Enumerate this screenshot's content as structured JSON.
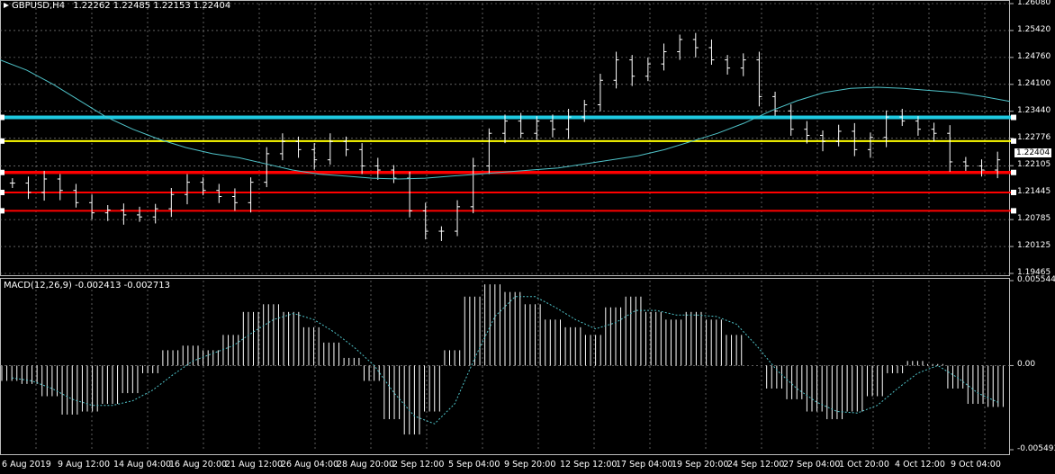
{
  "header": {
    "symbol": "GBPUSD,H4",
    "ohlc": "1.22262 1.22485 1.22153 1.22404"
  },
  "macd_header": {
    "label": "MACD(12,26,9) -0.002413 -0.002713"
  },
  "colors": {
    "background": "#000000",
    "candle": "#ffffff",
    "grid": "#9a9a9a",
    "ma": "#4fc3c9",
    "resistance": "#1ec9e0",
    "mid_level": "#ffff00",
    "support": "#ff0000"
  },
  "chart_data": [
    {
      "type": "line",
      "title": "GBPUSD,H4",
      "ylim": [
        1.19465,
        1.2608
      ],
      "y_ticks": [
        "1.26080",
        "1.25420",
        "1.24760",
        "1.24100",
        "1.23440",
        "1.22776",
        "1.22404",
        "1.22105",
        "1.21445",
        "1.20785",
        "1.20125",
        "1.19465"
      ],
      "x_ticks": [
        "6 Aug 2019",
        "9 Aug 12:00",
        "14 Aug 04:00",
        "16 Aug 20:00",
        "21 Aug 12:00",
        "26 Aug 04:00",
        "28 Aug 20:00",
        "2 Sep 12:00",
        "5 Sep 04:00",
        "9 Sep 20:00",
        "12 Sep 12:00",
        "17 Sep 04:00",
        "19 Sep 20:00",
        "24 Sep 12:00",
        "27 Sep 04:00",
        "1 Oct 20:00",
        "4 Oct 12:00",
        "9 Oct 04:00"
      ],
      "current_price": "1.22404",
      "series": [
        {
          "type": "price",
          "values": [
            1.2168,
            1.2145,
            1.2178,
            1.215,
            1.212,
            1.2095,
            1.2102,
            1.209,
            1.2085,
            1.2105,
            1.214,
            1.217,
            1.215,
            1.2135,
            1.212,
            1.217,
            1.224,
            1.227,
            1.225,
            1.2225,
            1.227,
            1.225,
            1.221,
            1.22,
            1.218,
            1.21,
            1.205,
            1.205,
            1.211,
            1.221,
            1.229,
            1.232,
            1.229,
            1.232,
            1.23,
            1.233,
            1.236,
            1.242,
            1.247,
            1.243,
            1.246,
            1.249,
            1.252,
            1.25,
            1.247,
            1.245,
            1.247,
            1.238,
            1.2345,
            1.23,
            1.2285,
            1.227,
            1.2295,
            1.225,
            1.228,
            1.233,
            1.232,
            1.23,
            1.229,
            1.222,
            1.221,
            1.22,
            1.2225
          ]
        },
        {
          "type": "moving_average",
          "values": [
            1.247,
            1.2445,
            1.241,
            1.237,
            1.233,
            1.23,
            1.2275,
            1.2255,
            1.224,
            1.223,
            1.2215,
            1.22,
            1.219,
            1.2185,
            1.218,
            1.2178,
            1.218,
            1.2185,
            1.219,
            1.2195,
            1.22,
            1.2205,
            1.2215,
            1.2225,
            1.2235,
            1.225,
            1.227,
            1.229,
            1.2315,
            1.2345,
            1.237,
            1.239,
            1.24,
            1.2403,
            1.24,
            1.2395,
            1.239,
            1.238,
            1.2368
          ]
        }
      ],
      "horizontal_levels": [
        {
          "name": "resistance",
          "value": 1.2329,
          "color": "#1ec9e0"
        },
        {
          "name": "mid",
          "value": 1.2271,
          "color": "#ffff00"
        },
        {
          "name": "support-1",
          "value": 1.2194,
          "color": "#ff0000"
        },
        {
          "name": "support-2",
          "value": 1.2145,
          "color": "#ff0000"
        },
        {
          "name": "support-3",
          "value": 1.21,
          "color": "#ff0000"
        }
      ]
    },
    {
      "type": "bar",
      "title": "MACD(12,26,9) -0.002413 -0.002713",
      "ylim": [
        -0.005493,
        0.005544
      ],
      "y_ticks": [
        "0.005544",
        "0.00",
        "-0.005493"
      ],
      "series": [
        {
          "name": "MACD",
          "values": [
            -0.001,
            -0.0012,
            -0.002,
            -0.0032,
            -0.003,
            -0.0025,
            -0.0018,
            -0.0005,
            0.001,
            0.0013,
            0.001,
            0.002,
            0.0035,
            0.004,
            0.0035,
            0.0025,
            0.0015,
            0.0005,
            -0.001,
            -0.0035,
            -0.0045,
            -0.003,
            0.001,
            0.0045,
            0.0053,
            0.0048,
            0.004,
            0.003,
            0.0025,
            0.002,
            0.0038,
            0.0045,
            0.0035,
            0.003,
            0.0035,
            0.003,
            0.002,
            0.0,
            -0.0015,
            -0.0022,
            -0.003,
            -0.0035,
            -0.003,
            -0.002,
            -0.0005,
            0.0003,
            0.0001,
            -0.0015,
            -0.0025,
            -0.0027
          ]
        },
        {
          "name": "Signal",
          "values": [
            -0.0008,
            -0.001,
            -0.0015,
            -0.0022,
            -0.0026,
            -0.0026,
            -0.0023,
            -0.0016,
            -0.0006,
            0.0003,
            0.0008,
            0.0013,
            0.0022,
            0.003,
            0.0034,
            0.003,
            0.0022,
            0.0012,
            0.0,
            -0.0018,
            -0.0033,
            -0.0038,
            -0.0025,
            0.0005,
            0.0032,
            0.0045,
            0.0045,
            0.0038,
            0.003,
            0.0024,
            0.0028,
            0.0036,
            0.0036,
            0.0033,
            0.0033,
            0.0032,
            0.0027,
            0.0013,
            -0.0003,
            -0.0015,
            -0.0024,
            -0.003,
            -0.0031,
            -0.0026,
            -0.0015,
            -0.0005,
            0.0,
            -0.0008,
            -0.0018,
            -0.0024
          ]
        }
      ]
    }
  ]
}
